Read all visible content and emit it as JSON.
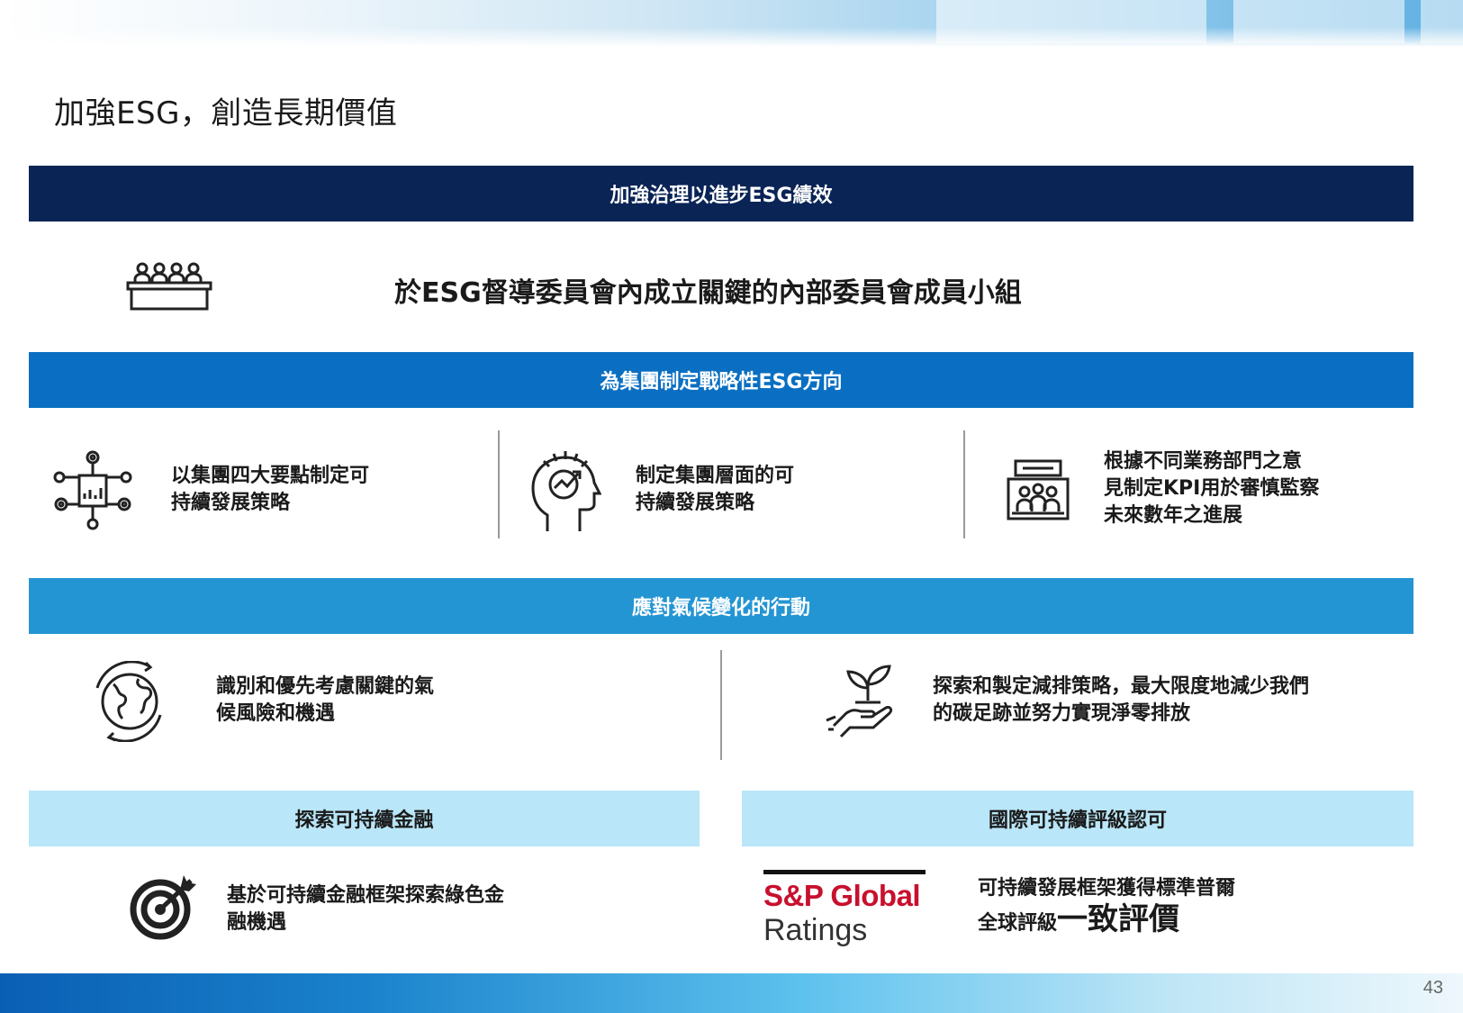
{
  "title": "加強ESG，創造長期價值",
  "sections": {
    "governance": {
      "header": "加強治理以進步ESG績效",
      "statement": "於ESG督導委員會內成立關鍵的內部委員會成員小組"
    },
    "strategy": {
      "header": "為集團制定戰略性ESG方向",
      "items": [
        {
          "line1": "以集團四大要點制定可",
          "line2": "持續發展策略"
        },
        {
          "line1": "制定集團層面的可",
          "line2": "持續發展策略"
        },
        {
          "line1": "根據不同業務部門之意",
          "line2": "見制定KPI用於審慎監察",
          "line3": "未來數年之進展"
        }
      ]
    },
    "climate": {
      "header": "應對氣候變化的行動",
      "items": [
        {
          "line1": "識別和優先考慮關鍵的氣",
          "line2": "候風險和機遇"
        },
        {
          "line1": "探索和製定減排策略，最大限度地減少我們",
          "line2": "的碳足跡並努力實現淨零排放"
        }
      ]
    },
    "finance": {
      "header": "探索可持續金融",
      "line1": "基於可持續金融框架探索綠色金",
      "line2": "融機遇"
    },
    "rating": {
      "header": "國際可持續評級認可",
      "logo_name": "S&P Global",
      "logo_sub": "Ratings",
      "line1": "可持續發展框架獲得標準普爾",
      "line2_small": "全球評級",
      "line2_big": "一致評價"
    }
  },
  "page_number": "43",
  "colors": {
    "navy": "#0a2456",
    "blue": "#0a6fc2",
    "mid_blue": "#2495d3",
    "light_blue": "#b9e6f8",
    "sp_red": "#c8102e"
  },
  "icons": [
    "committee-icon",
    "network-chart-icon",
    "head-growth-icon",
    "meeting-board-icon",
    "globe-cycle-icon",
    "hand-plant-icon",
    "target-arrow-icon"
  ]
}
